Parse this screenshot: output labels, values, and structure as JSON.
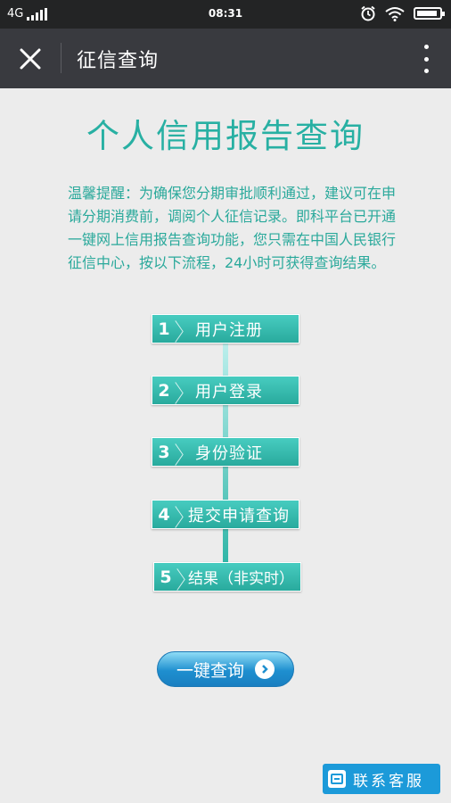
{
  "status_bar": {
    "network": "4G",
    "time": "08:31"
  },
  "header": {
    "title": "征信查询"
  },
  "content": {
    "title": "个人信用报告查询",
    "notice": "温馨提醒：为确保您分期审批顺利通过，建议可在申请分期消费前，调阅个人征信记录。即科平台已开通一键网上信用报告查询功能，您只需在中国人民银行征信中心，按以下流程，24小时可获得查询结果。",
    "steps": [
      {
        "num": "1",
        "label": "用户注册"
      },
      {
        "num": "2",
        "label": "用户登录"
      },
      {
        "num": "3",
        "label": "身份验证"
      },
      {
        "num": "4",
        "label": "提交申请查询"
      },
      {
        "num": "5",
        "label": "结果（非实时）"
      }
    ],
    "query_button": "一键查询",
    "contact_button": "联系客服"
  },
  "colors": {
    "accent": "#28b0a3",
    "header_bg": "#393a3f",
    "button_blue": "#1e8fcf"
  }
}
